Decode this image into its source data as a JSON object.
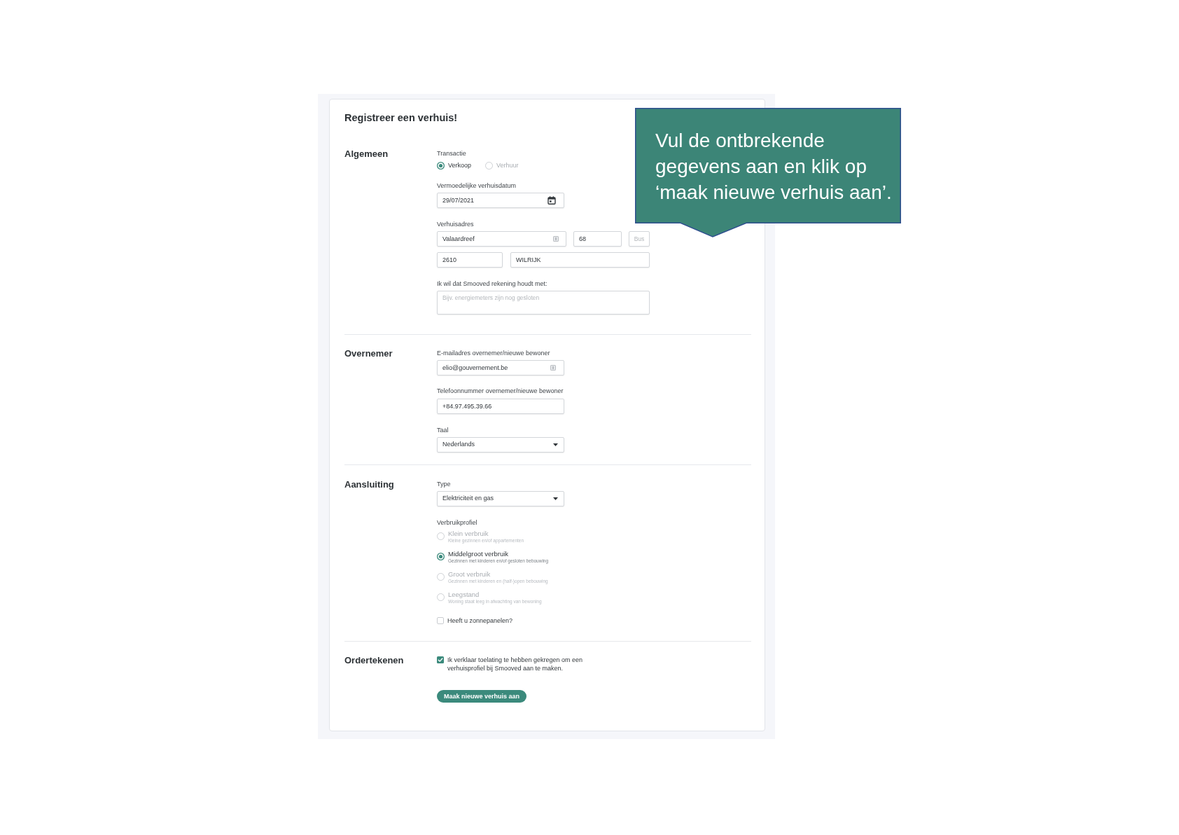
{
  "form": {
    "title": "Registreer een verhuis!",
    "sections": [
      {
        "title": "Algemeen",
        "fields": [
          {
            "kind": "radio_group",
            "label": "Transactie",
            "options": [
              {
                "label": "Verkoop",
                "selected": true
              },
              {
                "label": "Verhuur",
                "selected": false
              }
            ]
          },
          {
            "kind": "date",
            "label": "Vermoedelijke verhuisdatum",
            "value": "29/07/2021"
          },
          {
            "kind": "address",
            "label": "Verhuisadres",
            "street": {
              "value": "Valaardreef"
            },
            "number": {
              "value": "68"
            },
            "bus": {
              "placeholder": "Bus"
            },
            "postcode": {
              "value": "2610"
            },
            "city": {
              "value": "WILRIJK"
            }
          },
          {
            "kind": "textarea",
            "label": "Ik wil dat Smooved rekening houdt met:",
            "placeholder": "Bijv. energiemeters zijn nog gesloten"
          }
        ]
      },
      {
        "title": "Overnemer",
        "fields": [
          {
            "kind": "email",
            "label": "E-mailadres overnemer/nieuwe bewoner",
            "value": "elio@gouvernement.be"
          },
          {
            "kind": "tel",
            "label": "Telefoonnummer overnemer/nieuwe bewoner",
            "value": "+84.97.495.39.66"
          },
          {
            "kind": "select",
            "label": "Taal",
            "value": "Nederlands"
          }
        ]
      },
      {
        "title": "Aansluiting",
        "fields": [
          {
            "kind": "select",
            "label": "Type",
            "value": "Elektriciteit en gas"
          },
          {
            "kind": "radio_list",
            "label": "Verbruikprofiel",
            "options": [
              {
                "label": "Klein verbruik",
                "description": "Kleine gezinnen en/of appartementen",
                "selected": false
              },
              {
                "label": "Middelgroot verbruik",
                "description": "Gezinnen met kinderen en/of gesloten bebouwing",
                "selected": true
              },
              {
                "label": "Groot verbruik",
                "description": "Gezinnen met kinderen en (half-)open bebouwing",
                "selected": false
              },
              {
                "label": "Leegstand",
                "description": "Woning staat leeg in afwachting van bewoning",
                "selected": false
              }
            ]
          },
          {
            "kind": "checkbox",
            "label": "Heeft u zonnepanelen?",
            "checked": false
          }
        ]
      },
      {
        "title": "Ordertekenen",
        "fields": [
          {
            "kind": "checkbox",
            "label": "Ik verklaar toelating te hebben gekregen om een verhuisprofiel bij Smooved aan te maken.",
            "checked": true
          },
          {
            "kind": "button",
            "label": "Maak nieuwe verhuis aan"
          }
        ]
      }
    ]
  },
  "callout": {
    "text": "Vul de ontbrekende gegevens aan en klik op ‘maak nieuwe verhuis aan’."
  }
}
